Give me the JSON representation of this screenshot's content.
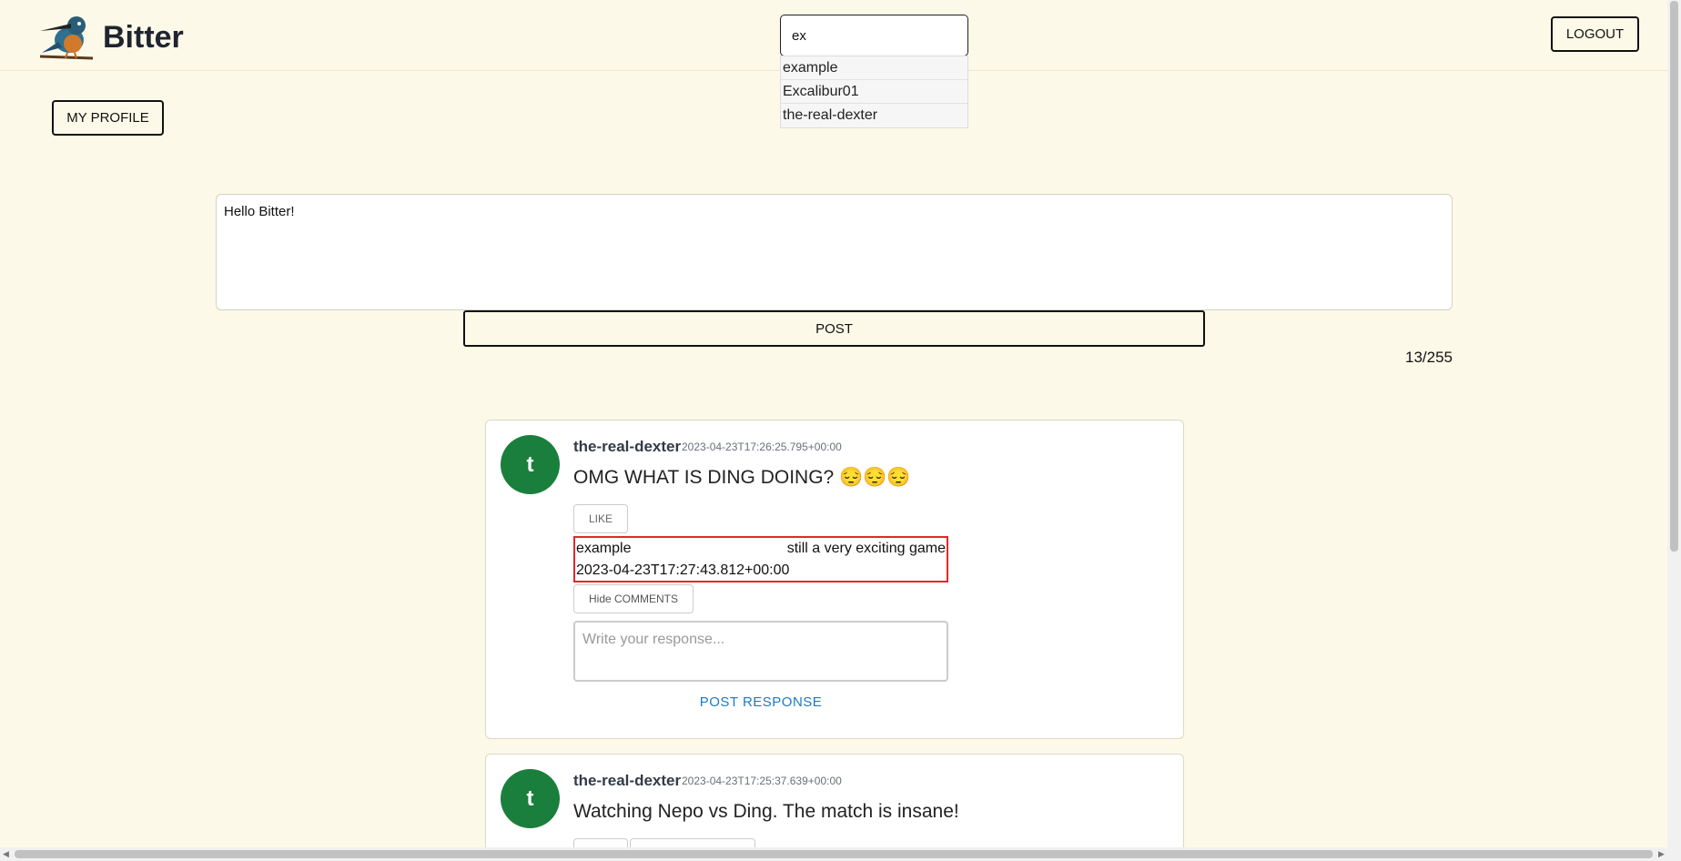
{
  "header": {
    "brand": "Bitter",
    "logout_label": "LOGOUT"
  },
  "search": {
    "value": "ex",
    "suggestions": [
      "example",
      "Excalibur01",
      "the-real-dexter"
    ]
  },
  "profile": {
    "my_profile_label": "MY PROFILE"
  },
  "compose": {
    "value": "Hello Bitter!",
    "post_label": "POST",
    "char_count": "13/255"
  },
  "posts": [
    {
      "avatar_letter": "t",
      "username": "the-real-dexter",
      "timestamp": "2023-04-23T17:26:25.795+00:00",
      "text": "OMG WHAT IS DING DOING? 😔😔😔",
      "like_label": "LIKE",
      "comment": {
        "user": "example",
        "text": "still a very exciting game",
        "time": "2023-04-23T17:27:43.812+00:00"
      },
      "hide_comments_label": "Hide COMMENTS",
      "response_placeholder": "Write your response...",
      "post_response_label": "POST RESPONSE"
    },
    {
      "avatar_letter": "t",
      "username": "the-real-dexter",
      "timestamp": "2023-04-23T17:25:37.639+00:00",
      "text": "Watching Nepo vs Ding. The match is insane!"
    }
  ],
  "colors": {
    "background": "#fdf9e8",
    "avatar": "#1a7f3c",
    "comment_border": "#e0282c",
    "link": "#1d7ac8"
  }
}
